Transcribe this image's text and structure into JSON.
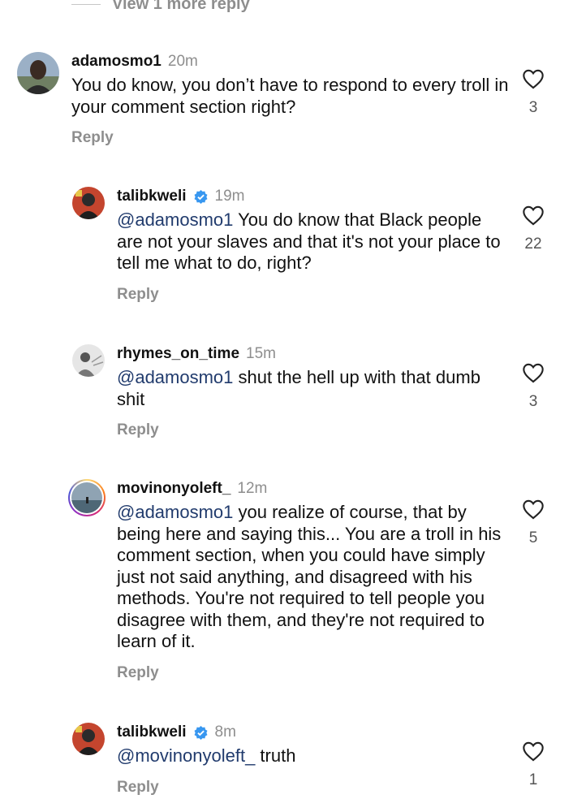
{
  "view_more": "View 1 more reply",
  "comments": [
    {
      "username": "adamosmo1",
      "time": "20m",
      "verified": false,
      "mention": "",
      "text": "You do know, you don’t have to respond to every troll in your comment section right?",
      "reply": "Reply",
      "likes": "3"
    },
    {
      "username": "talibkweli",
      "time": "19m",
      "verified": true,
      "mention": "@adamosmo1",
      "text": " You do know that Black people are not your slaves and that it's not your place to tell me what to do, right?",
      "reply": "Reply",
      "likes": "22"
    },
    {
      "username": "rhymes_on_time",
      "time": "15m",
      "verified": false,
      "mention": "@adamosmo1",
      "text": " shut the hell up with that dumb shit",
      "reply": "Reply",
      "likes": "3"
    },
    {
      "username": "movinonyoleft_",
      "time": "12m",
      "verified": false,
      "mention": "@adamosmo1",
      "text": " you realize of course, that by being here and saying this... You are a troll in his comment section, when you could have simply just not said anything, and disagreed with his methods. You're not required to tell people you disagree with them, and they're not required to learn of it.",
      "reply": "Reply",
      "likes": "5"
    },
    {
      "username": "talibkweli",
      "time": "8m",
      "verified": true,
      "mention": "@movinonyoleft_",
      "text": " truth",
      "reply": "Reply",
      "likes": "1"
    }
  ],
  "colors": {
    "mention": "#213b6d",
    "verified": "#3897f0",
    "muted": "#8e8e8e"
  }
}
